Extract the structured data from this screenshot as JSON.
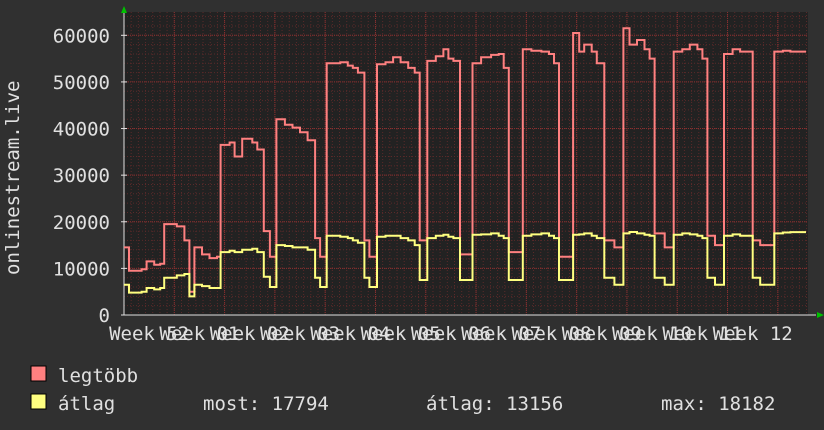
{
  "chart_data": {
    "type": "line",
    "ylabel": "onlinestream.live",
    "ylim": [
      0,
      65000
    ],
    "yticks": [
      0,
      10000,
      20000,
      30000,
      40000,
      50000,
      60000
    ],
    "ytick_labels": [
      "0",
      "10000",
      "20000",
      "30000",
      "40000",
      "50000",
      "60000"
    ],
    "xtick_labels": [
      "Week 52",
      "Week 01",
      "Week 02",
      "Week 03",
      "Week 04",
      "Week 05",
      "Week 06",
      "Week 07",
      "Week 08",
      "Week 09",
      "Week 10",
      "Week 11",
      "Week 12"
    ],
    "grid": true,
    "x_range_weeks": [
      0,
      13.6
    ],
    "series": [
      {
        "name": "legtöbb",
        "color": "#ff8080",
        "points": [
          [
            0.0,
            14500
          ],
          [
            0.1,
            9500
          ],
          [
            0.35,
            9800
          ],
          [
            0.45,
            11500
          ],
          [
            0.6,
            10800
          ],
          [
            0.72,
            11000
          ],
          [
            0.8,
            19500
          ],
          [
            1.05,
            19000
          ],
          [
            1.2,
            16000
          ],
          [
            1.3,
            5000
          ],
          [
            1.4,
            14500
          ],
          [
            1.55,
            13000
          ],
          [
            1.7,
            12200
          ],
          [
            1.85,
            12500
          ],
          [
            1.92,
            36500
          ],
          [
            2.1,
            37000
          ],
          [
            2.2,
            34000
          ],
          [
            2.35,
            37800
          ],
          [
            2.55,
            37000
          ],
          [
            2.65,
            35500
          ],
          [
            2.78,
            18000
          ],
          [
            2.9,
            12500
          ],
          [
            3.03,
            42000
          ],
          [
            3.2,
            40800
          ],
          [
            3.35,
            40200
          ],
          [
            3.5,
            39200
          ],
          [
            3.65,
            37500
          ],
          [
            3.8,
            16500
          ],
          [
            3.9,
            12500
          ],
          [
            4.03,
            54000
          ],
          [
            4.3,
            54200
          ],
          [
            4.45,
            53500
          ],
          [
            4.55,
            53000
          ],
          [
            4.65,
            52000
          ],
          [
            4.78,
            16000
          ],
          [
            4.88,
            12500
          ],
          [
            5.03,
            53800
          ],
          [
            5.2,
            54200
          ],
          [
            5.35,
            55300
          ],
          [
            5.5,
            54200
          ],
          [
            5.65,
            53000
          ],
          [
            5.78,
            52000
          ],
          [
            5.88,
            16000
          ],
          [
            6.03,
            54500
          ],
          [
            6.2,
            55500
          ],
          [
            6.35,
            57000
          ],
          [
            6.45,
            55000
          ],
          [
            6.55,
            54500
          ],
          [
            6.68,
            13000
          ],
          [
            6.93,
            54000
          ],
          [
            7.1,
            55300
          ],
          [
            7.3,
            55800
          ],
          [
            7.45,
            56000
          ],
          [
            7.55,
            53000
          ],
          [
            7.65,
            13500
          ],
          [
            7.93,
            57000
          ],
          [
            8.1,
            56700
          ],
          [
            8.3,
            56500
          ],
          [
            8.45,
            56000
          ],
          [
            8.55,
            54000
          ],
          [
            8.65,
            12500
          ],
          [
            8.93,
            60500
          ],
          [
            9.05,
            56500
          ],
          [
            9.15,
            58000
          ],
          [
            9.3,
            56500
          ],
          [
            9.4,
            54000
          ],
          [
            9.55,
            16000
          ],
          [
            9.75,
            14500
          ],
          [
            9.93,
            61500
          ],
          [
            10.05,
            58000
          ],
          [
            10.2,
            59000
          ],
          [
            10.35,
            57000
          ],
          [
            10.45,
            55000
          ],
          [
            10.55,
            17500
          ],
          [
            10.75,
            14500
          ],
          [
            10.93,
            56500
          ],
          [
            11.1,
            57000
          ],
          [
            11.25,
            58000
          ],
          [
            11.4,
            57000
          ],
          [
            11.5,
            55000
          ],
          [
            11.6,
            17000
          ],
          [
            11.75,
            15000
          ],
          [
            11.93,
            56000
          ],
          [
            12.1,
            57000
          ],
          [
            12.25,
            56500
          ],
          [
            12.5,
            16000
          ],
          [
            12.65,
            15000
          ],
          [
            12.93,
            56500
          ],
          [
            13.1,
            56700
          ],
          [
            13.25,
            56500
          ]
        ]
      },
      {
        "name": "átlag",
        "color": "#ffff80",
        "points": [
          [
            0.0,
            6500
          ],
          [
            0.1,
            4800
          ],
          [
            0.35,
            5000
          ],
          [
            0.45,
            5800
          ],
          [
            0.6,
            5500
          ],
          [
            0.72,
            5800
          ],
          [
            0.8,
            8000
          ],
          [
            1.05,
            8500
          ],
          [
            1.2,
            8800
          ],
          [
            1.3,
            4000
          ],
          [
            1.4,
            6500
          ],
          [
            1.55,
            6200
          ],
          [
            1.7,
            5800
          ],
          [
            1.85,
            5800
          ],
          [
            1.92,
            13500
          ],
          [
            2.1,
            13800
          ],
          [
            2.2,
            13500
          ],
          [
            2.35,
            14000
          ],
          [
            2.55,
            14200
          ],
          [
            2.65,
            13500
          ],
          [
            2.78,
            8200
          ],
          [
            2.9,
            6000
          ],
          [
            3.03,
            15000
          ],
          [
            3.2,
            14800
          ],
          [
            3.35,
            14500
          ],
          [
            3.5,
            14500
          ],
          [
            3.65,
            14000
          ],
          [
            3.8,
            8000
          ],
          [
            3.9,
            6000
          ],
          [
            4.03,
            17000
          ],
          [
            4.3,
            16800
          ],
          [
            4.45,
            16500
          ],
          [
            4.55,
            16000
          ],
          [
            4.65,
            15500
          ],
          [
            4.78,
            8000
          ],
          [
            4.88,
            6000
          ],
          [
            5.03,
            16800
          ],
          [
            5.2,
            17000
          ],
          [
            5.35,
            17000
          ],
          [
            5.5,
            16500
          ],
          [
            5.65,
            16000
          ],
          [
            5.78,
            15000
          ],
          [
            5.88,
            7500
          ],
          [
            6.03,
            16500
          ],
          [
            6.2,
            17000
          ],
          [
            6.35,
            17200
          ],
          [
            6.45,
            16800
          ],
          [
            6.55,
            16500
          ],
          [
            6.68,
            7500
          ],
          [
            6.93,
            17200
          ],
          [
            7.1,
            17300
          ],
          [
            7.3,
            17500
          ],
          [
            7.45,
            17000
          ],
          [
            7.55,
            16500
          ],
          [
            7.65,
            7500
          ],
          [
            7.93,
            17000
          ],
          [
            8.1,
            17300
          ],
          [
            8.3,
            17500
          ],
          [
            8.45,
            17000
          ],
          [
            8.55,
            16500
          ],
          [
            8.65,
            7500
          ],
          [
            8.93,
            17200
          ],
          [
            9.05,
            17300
          ],
          [
            9.15,
            17500
          ],
          [
            9.3,
            17000
          ],
          [
            9.4,
            16500
          ],
          [
            9.55,
            8000
          ],
          [
            9.75,
            6500
          ],
          [
            9.93,
            17500
          ],
          [
            10.05,
            17800
          ],
          [
            10.2,
            17500
          ],
          [
            10.35,
            17200
          ],
          [
            10.45,
            17000
          ],
          [
            10.55,
            8000
          ],
          [
            10.75,
            6500
          ],
          [
            10.93,
            17200
          ],
          [
            11.1,
            17500
          ],
          [
            11.25,
            17300
          ],
          [
            11.4,
            17000
          ],
          [
            11.5,
            16500
          ],
          [
            11.6,
            8000
          ],
          [
            11.75,
            6500
          ],
          [
            11.93,
            17000
          ],
          [
            12.1,
            17300
          ],
          [
            12.25,
            17000
          ],
          [
            12.5,
            8000
          ],
          [
            12.65,
            6500
          ],
          [
            12.93,
            17500
          ],
          [
            13.1,
            17700
          ],
          [
            13.25,
            17794
          ]
        ]
      }
    ]
  },
  "legend": [
    {
      "label": "legtöbb",
      "color": "#ff8080"
    },
    {
      "label": "átlag",
      "color": "#ffff80"
    }
  ],
  "stats": {
    "most": "most: 17794",
    "atlag": "átlag: 13156",
    "max": "max: 18182"
  },
  "colors": {
    "background": "#303030",
    "plot_background": "#222222",
    "grid": "#5a2a2a",
    "axis": "#e0e0e0",
    "arrow": "#00c000"
  }
}
